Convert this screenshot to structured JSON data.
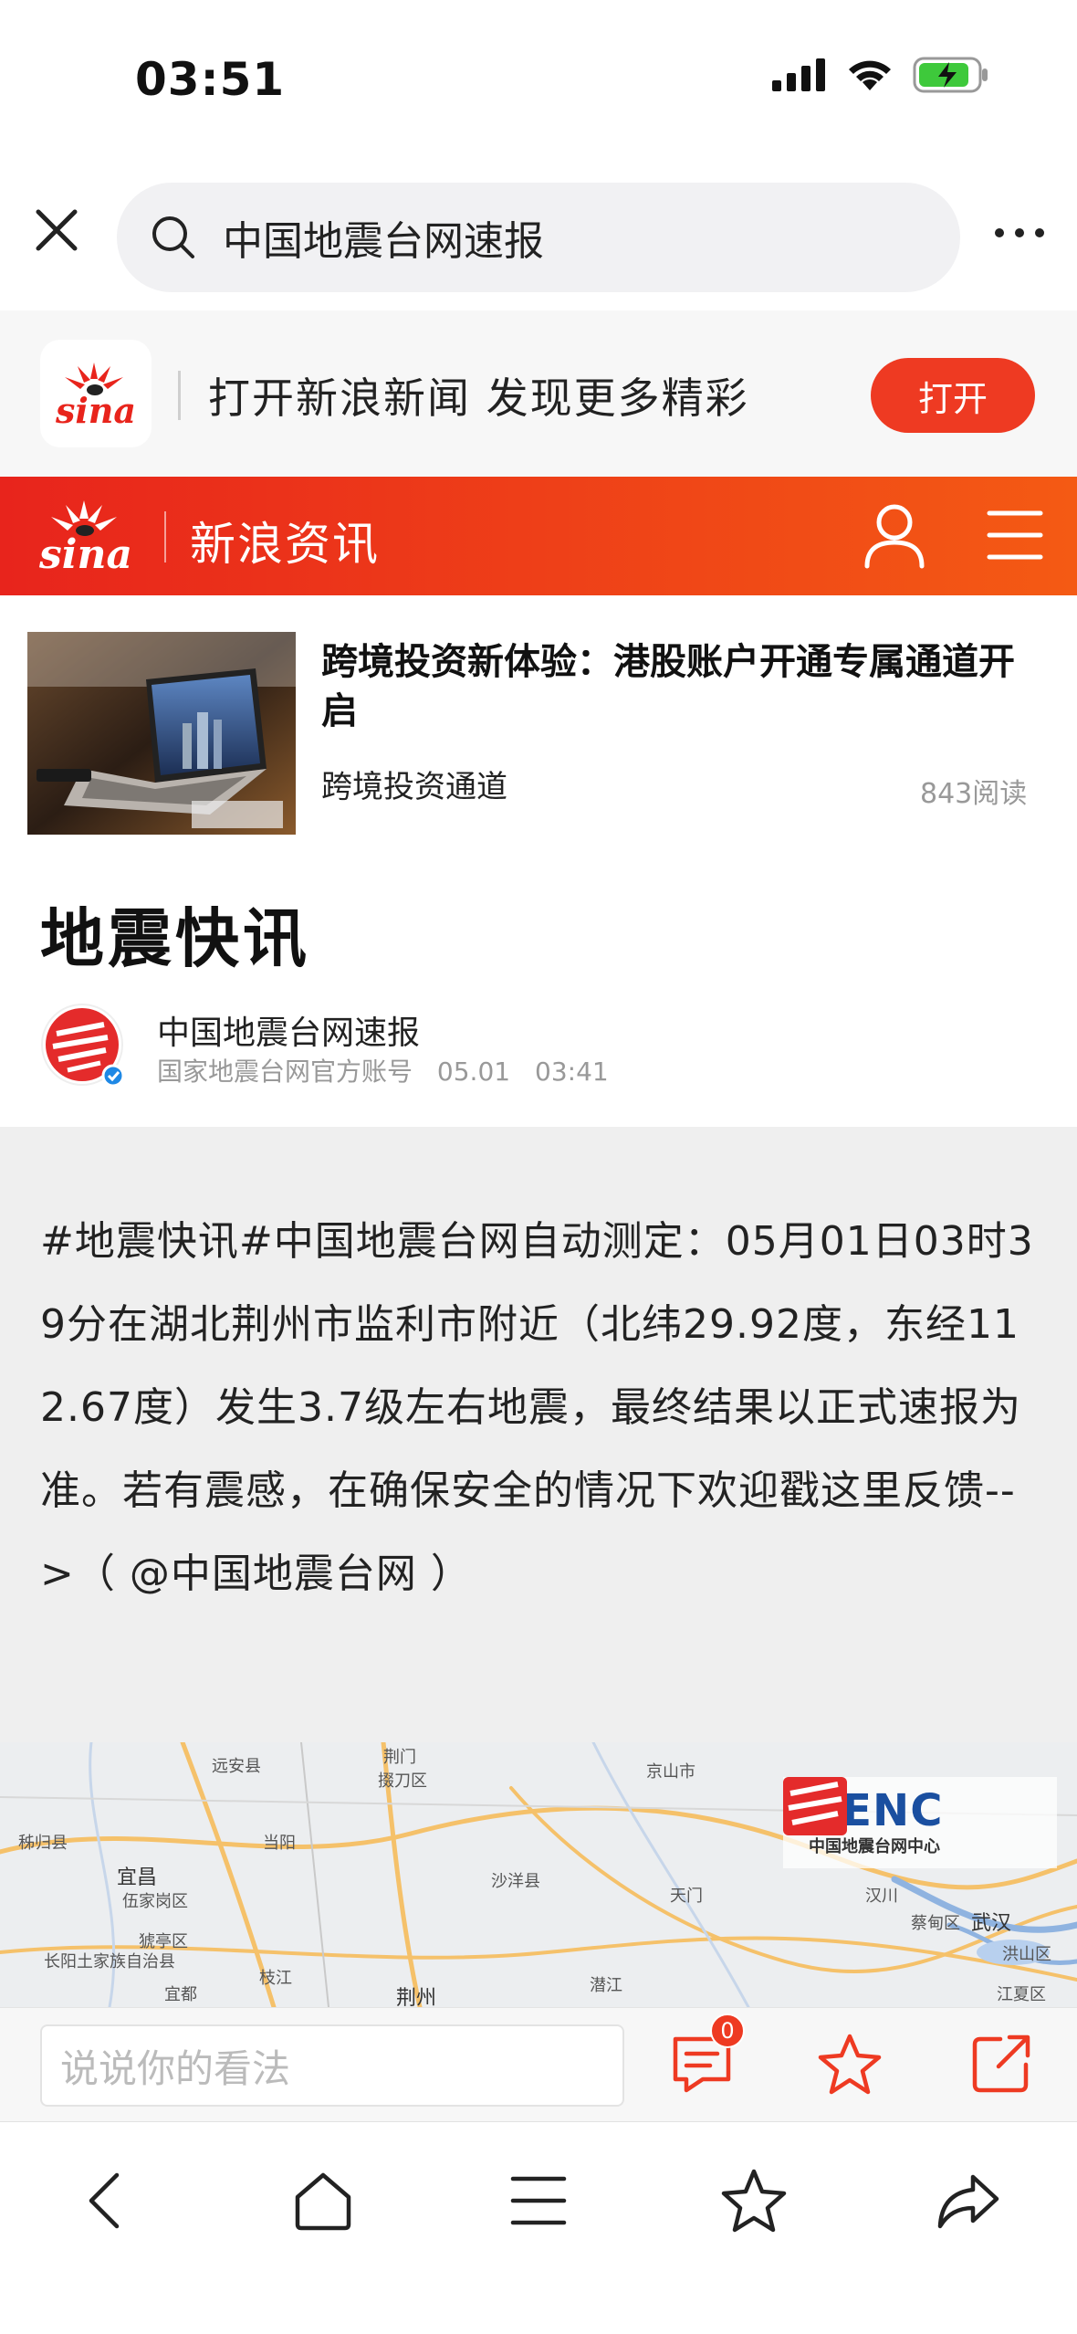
{
  "status_bar": {
    "time": "03:51"
  },
  "search": {
    "query": "中国地震台网速报"
  },
  "app_banner": {
    "logo_text": "sina",
    "text": "打开新浪新闻 发现更多精彩",
    "open_label": "打开"
  },
  "nav": {
    "logo_text": "sina",
    "title": "新浪资讯"
  },
  "ad": {
    "title": "跨境投资新体验：港股账户开通专属通道开启",
    "source": "跨境投资通道",
    "reads": "843阅读"
  },
  "article": {
    "title": "地震快讯",
    "author_name": "中国地震台网速报",
    "author_desc": "国家地震台网官方账号",
    "date": "05.01",
    "time": "03:41",
    "body": "#地震快讯#中国地震台网自动测定：05月01日03时39分在湖北荆州市监利市附近（北纬29.92度，东经112.67度）发生3.7级左右地震，最终结果以正式速报为准。若有震感，在确保安全的情况下欢迎戳这里反馈-->（ @中国地震台网 ）"
  },
  "map": {
    "logo_main": "CENC",
    "logo_sub": "中国地震台网中心",
    "labels": [
      "远安县",
      "荆门",
      "掇刀区",
      "京山市",
      "秭归县",
      "当阳",
      "沙洋县",
      "宜昌",
      "伍家岗区",
      "天门",
      "汉川",
      "蔡甸区",
      "武汉",
      "猇亭区",
      "长阳土家族自治县",
      "宜都",
      "枝江",
      "荆州",
      "潜江",
      "洪山区",
      "江夏区"
    ]
  },
  "comment_bar": {
    "placeholder": "说说你的看法",
    "comment_count": "0"
  },
  "colors": {
    "brand_red": "#ee3a22",
    "nav_gradient_start": "#e8241c",
    "nav_gradient_end": "#f45a14",
    "cenc_blue": "#1a4fa0"
  },
  "icons": [
    "close-icon",
    "search-icon",
    "more-icon",
    "sina-logo",
    "user-icon",
    "menu-icon",
    "comment-icon",
    "star-icon",
    "share-icon",
    "back-icon",
    "home-icon",
    "tabs-icon",
    "bookmark-icon",
    "forward-icon"
  ]
}
